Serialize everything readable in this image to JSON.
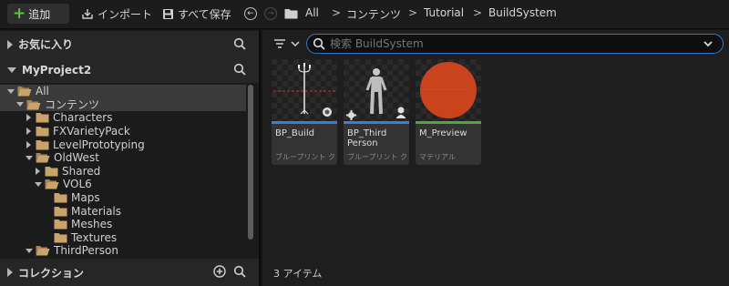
{
  "toolbar": {
    "add_label": "追加",
    "import_label": "インポート",
    "save_all_label": "すべて保存",
    "breadcrumbs": [
      "All",
      "コンテンツ",
      "Tutorial",
      "BuildSystem"
    ]
  },
  "left": {
    "favorites_label": "お気に入り",
    "project_label": "MyProject2",
    "collections_label": "コレクション",
    "tree": [
      {
        "label": "All"
      },
      {
        "label": "コンテンツ"
      },
      {
        "label": "Characters"
      },
      {
        "label": "FXVarietyPack"
      },
      {
        "label": "LevelPrototyping"
      },
      {
        "label": "OldWest"
      },
      {
        "label": "Shared"
      },
      {
        "label": "VOL6"
      },
      {
        "label": "Maps"
      },
      {
        "label": "Materials"
      },
      {
        "label": "Meshes"
      },
      {
        "label": "Textures"
      },
      {
        "label": "ThirdPerson"
      }
    ]
  },
  "search": {
    "placeholder": "検索 BuildSystem"
  },
  "assets": [
    {
      "name": "BP_Build",
      "type": "ブループリント クラス",
      "bar_color": "#3a7fd5"
    },
    {
      "name": "BP_Third Person",
      "type": "ブループリント クラス",
      "bar_color": "#3a7fd5"
    },
    {
      "name": "M_Preview",
      "type": "マテリアル",
      "bar_color": "#52a641"
    }
  ],
  "footer": {
    "item_count": "3 アイテム"
  },
  "colors": {
    "accent": "#2f79c7",
    "add_green": "#5fc341",
    "folder": "#c9a36a",
    "preview_sphere": "#c9431d"
  }
}
